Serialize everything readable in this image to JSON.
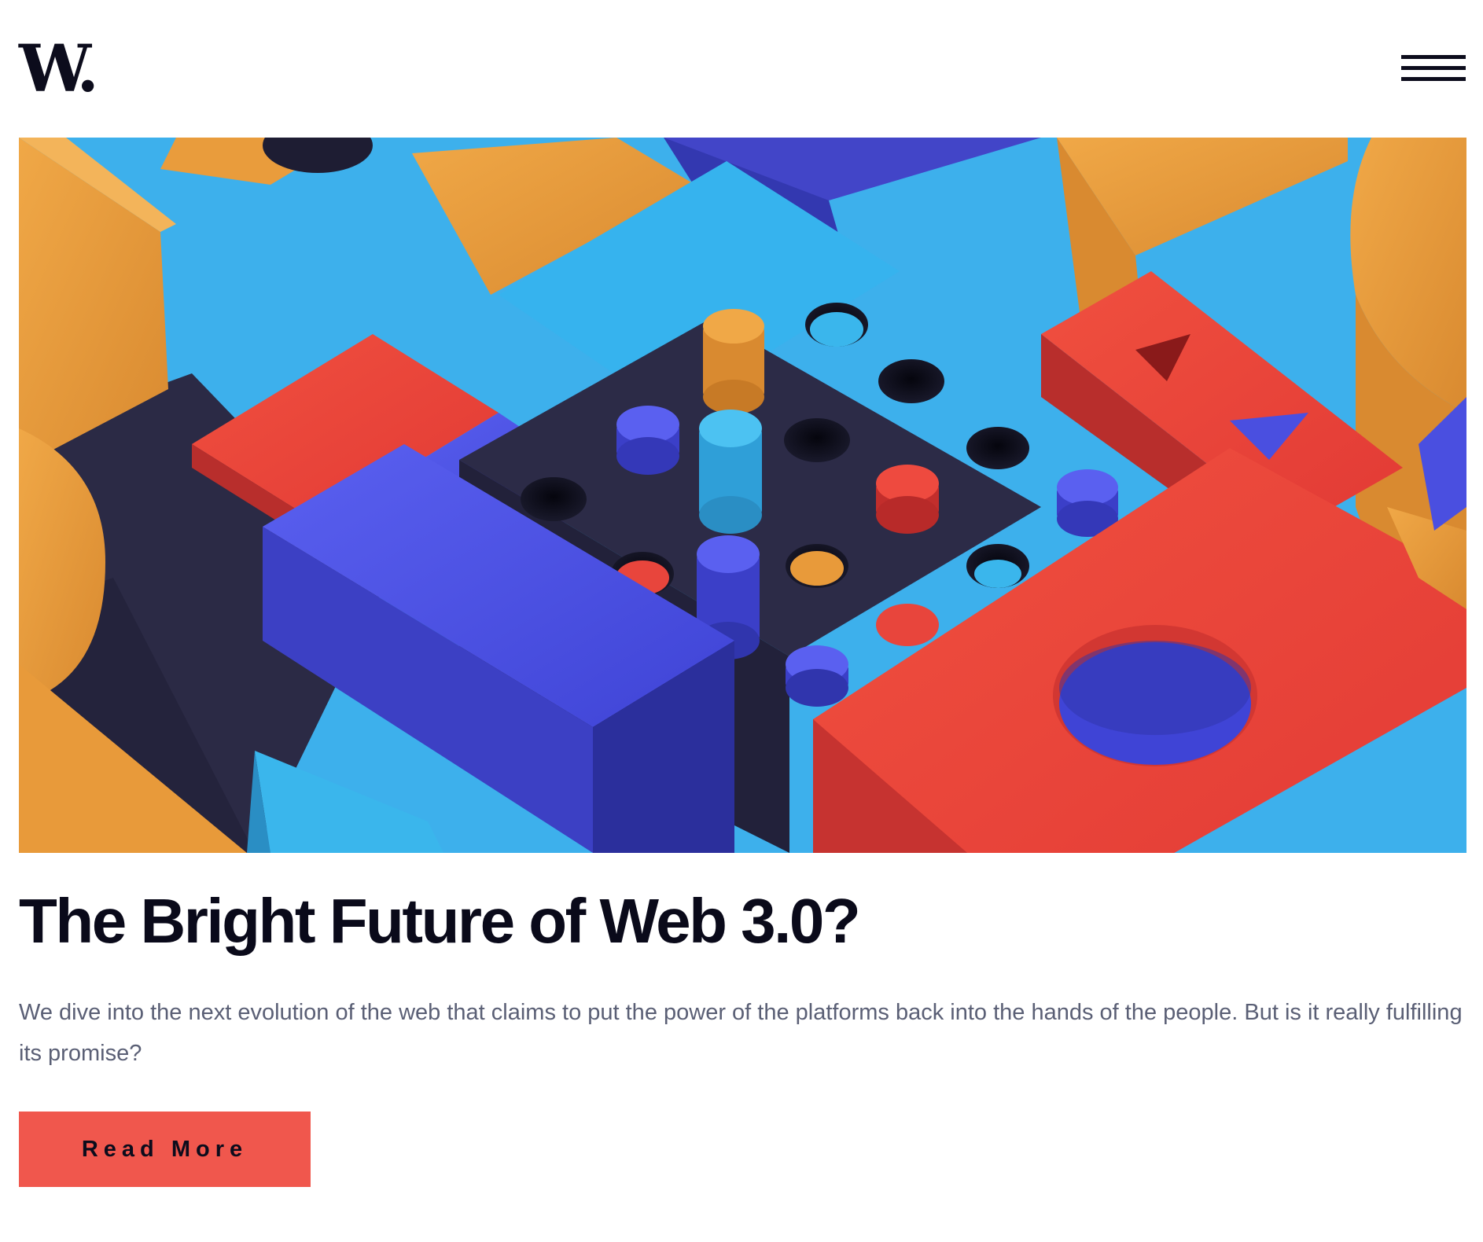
{
  "header": {
    "logo_text": "W.",
    "menu_icon": "hamburger-menu-icon"
  },
  "hero": {
    "image_description": "3D illustration of colorful wooden geometric blocks and a peg board",
    "colors": {
      "sky": "#3fb2ec",
      "orange": "#e89a3a",
      "red": "#e8453c",
      "blue": "#4a4fe0",
      "dark": "#2a2a44"
    }
  },
  "article": {
    "title": "The Bright Future of Web 3.0?",
    "excerpt": "We dive into the next evolution of the web that claims to put the power of the platforms back into the hands of the people. But is it really fulfilling its promise?",
    "cta_label": "Read More",
    "cta_color": "#f0574d"
  }
}
